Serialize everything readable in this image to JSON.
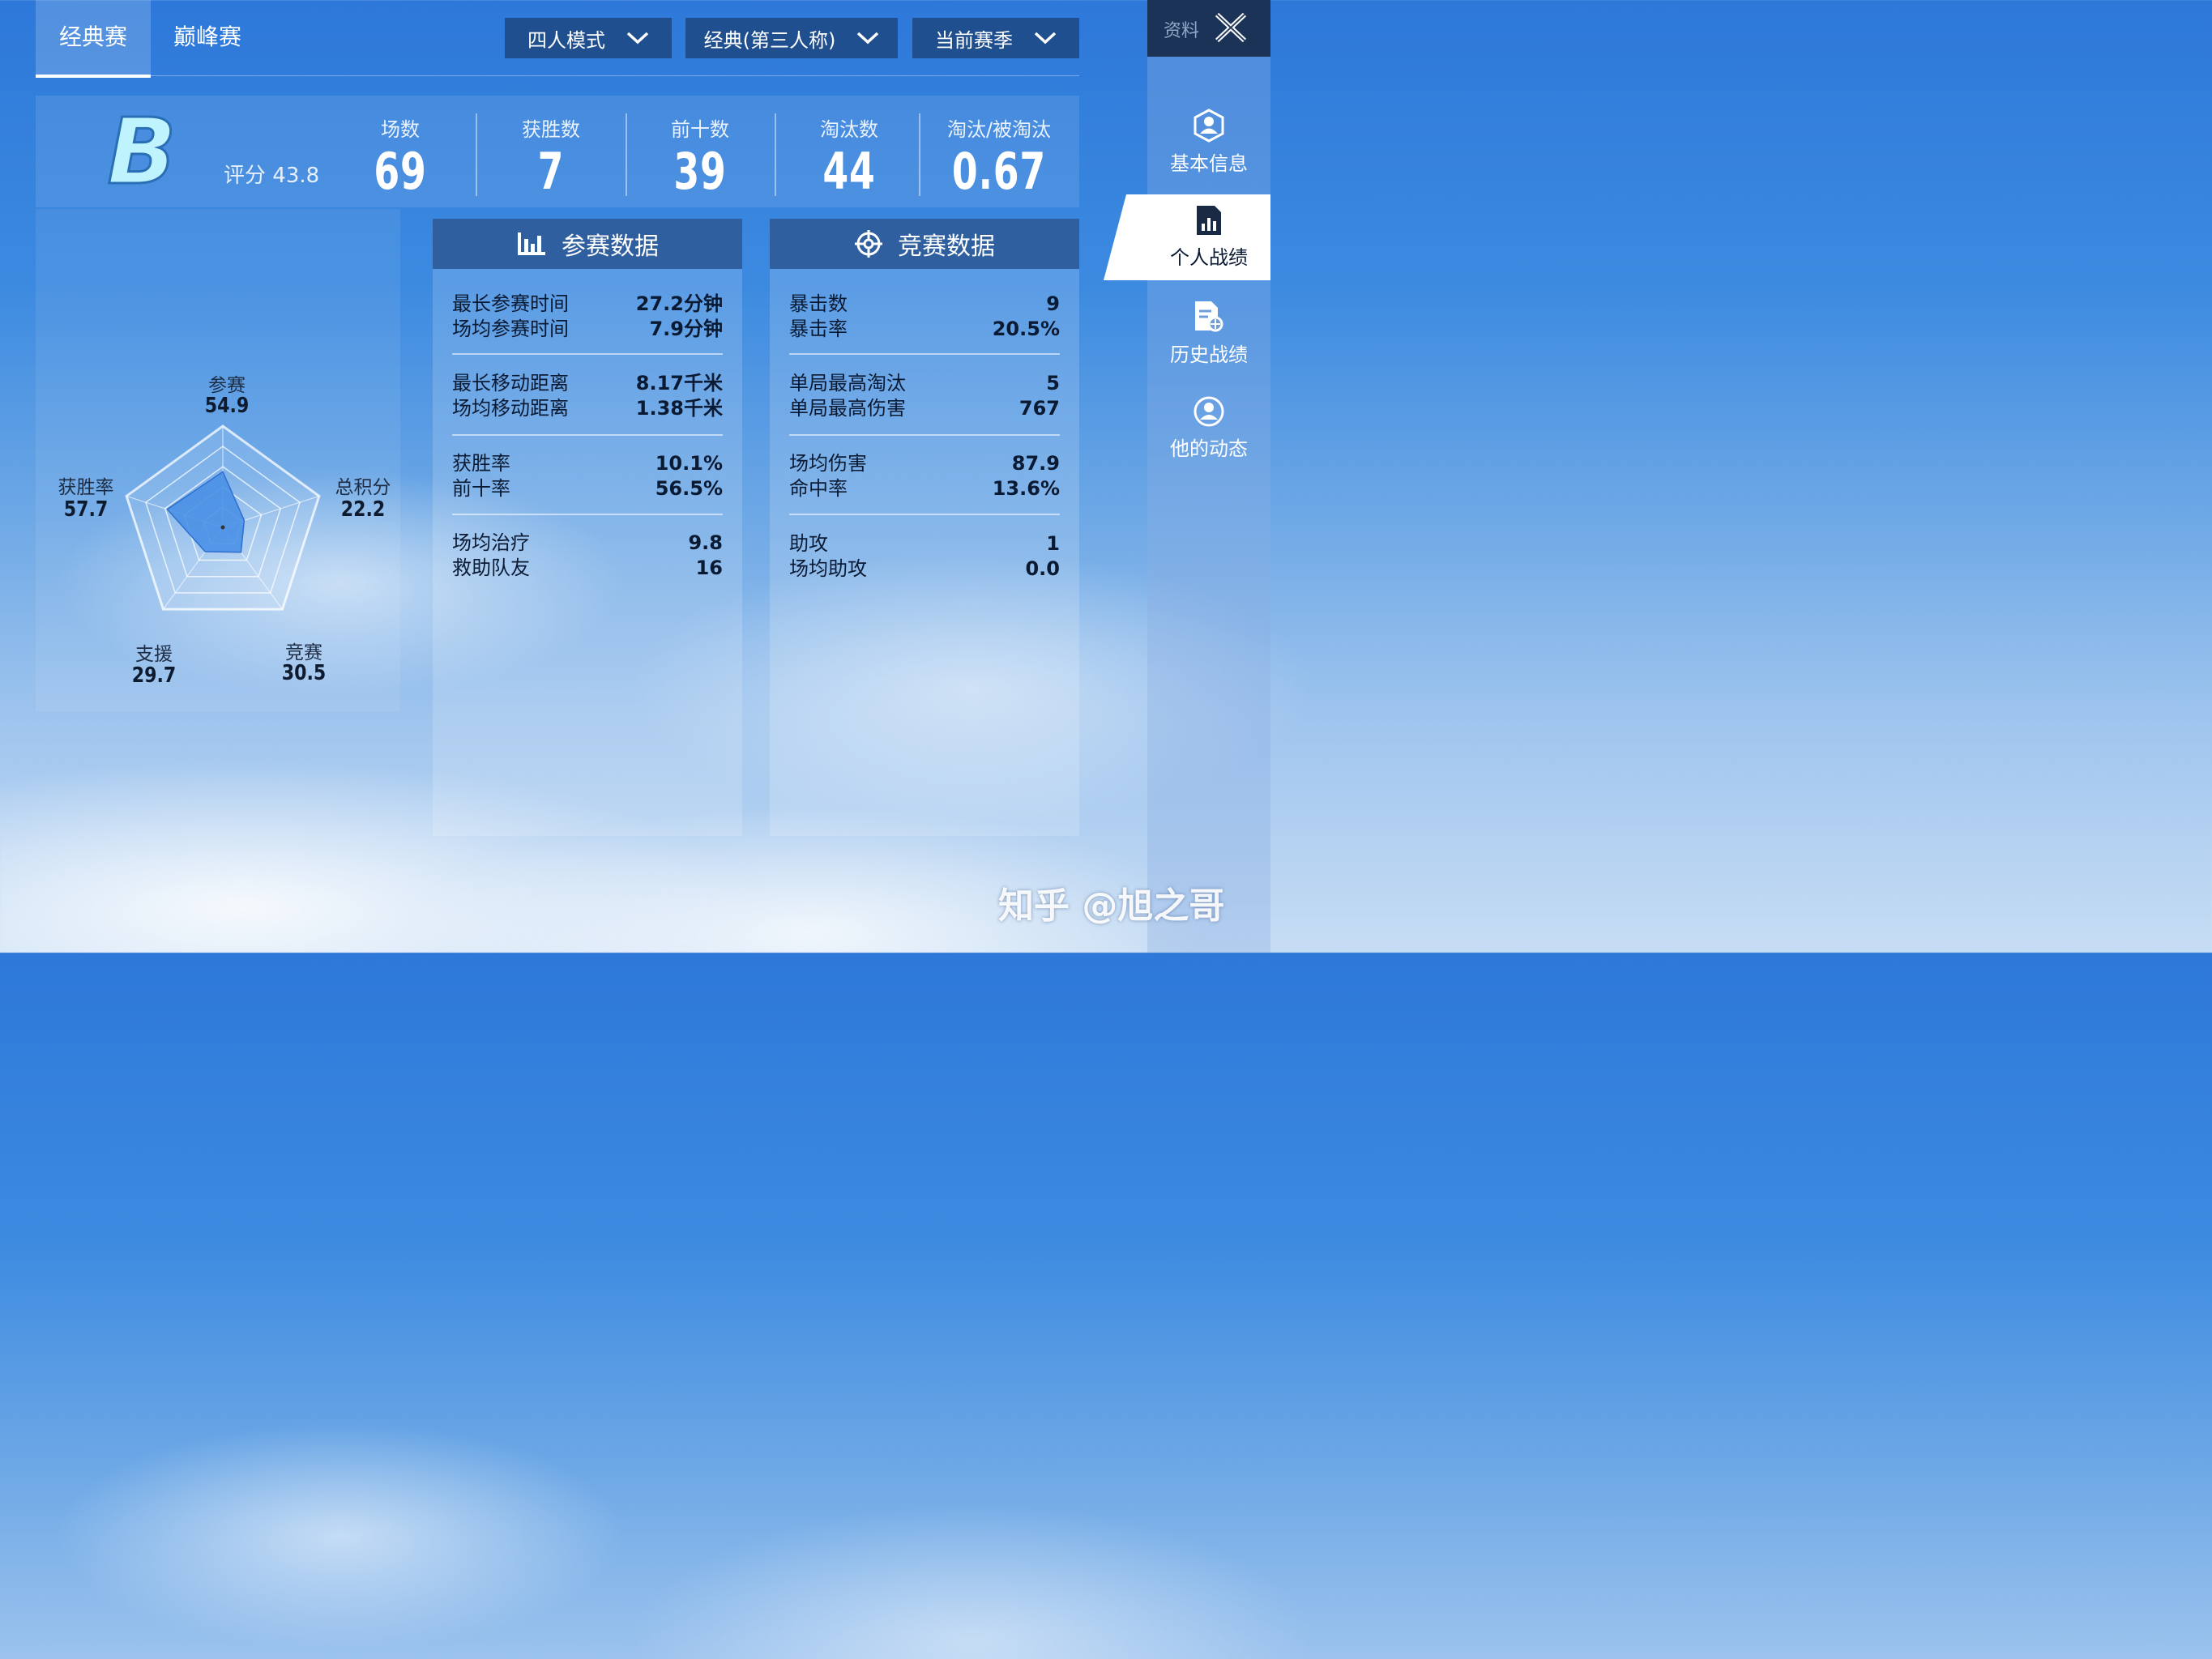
{
  "tabs": {
    "classic": "经典赛",
    "peak": "巅峰赛"
  },
  "filters": {
    "mode": "四人模式",
    "view": "经典(第三人称)",
    "season": "当前赛季"
  },
  "summary": {
    "grade": "B",
    "score_label": "评分",
    "score_value": "43.8",
    "stats": [
      {
        "label": "场数",
        "value": "69"
      },
      {
        "label": "获胜数",
        "value": "7"
      },
      {
        "label": "前十数",
        "value": "39"
      },
      {
        "label": "淘汰数",
        "value": "44"
      },
      {
        "label": "淘汰/被淘汰",
        "value": "0.67"
      }
    ]
  },
  "radar": {
    "axes": [
      {
        "label": "参赛",
        "value": "54.9"
      },
      {
        "label": "总积分",
        "value": "22.2"
      },
      {
        "label": "竞赛",
        "value": "30.5"
      },
      {
        "label": "支援",
        "value": "29.7"
      },
      {
        "label": "获胜率",
        "value": "57.7"
      }
    ]
  },
  "participation": {
    "title": "参赛数据",
    "groups": [
      [
        {
          "k": "最长参赛时间",
          "v": "27.2分钟"
        },
        {
          "k": "场均参赛时间",
          "v": "7.9分钟"
        }
      ],
      [
        {
          "k": "最长移动距离",
          "v": "8.17千米"
        },
        {
          "k": "场均移动距离",
          "v": "1.38千米"
        }
      ],
      [
        {
          "k": "获胜率",
          "v": "10.1%"
        },
        {
          "k": "前十率",
          "v": "56.5%"
        }
      ],
      [
        {
          "k": "场均治疗",
          "v": "9.8"
        },
        {
          "k": "救助队友",
          "v": "16"
        }
      ]
    ]
  },
  "combat": {
    "title": "竞赛数据",
    "groups": [
      [
        {
          "k": "暴击数",
          "v": "9"
        },
        {
          "k": "暴击率",
          "v": "20.5%"
        }
      ],
      [
        {
          "k": "单局最高淘汰",
          "v": "5"
        },
        {
          "k": "单局最高伤害",
          "v": "767"
        }
      ],
      [
        {
          "k": "场均伤害",
          "v": "87.9"
        },
        {
          "k": "命中率",
          "v": "13.6%"
        }
      ],
      [
        {
          "k": "助攻",
          "v": "1"
        },
        {
          "k": "场均助攻",
          "v": "0.0"
        }
      ]
    ]
  },
  "sidebar": {
    "header": "资料",
    "items": [
      {
        "label": "基本信息",
        "icon": "profile-hex-icon"
      },
      {
        "label": "个人战绩",
        "icon": "stats-doc-icon"
      },
      {
        "label": "历史战绩",
        "icon": "history-doc-icon"
      },
      {
        "label": "他的动态",
        "icon": "activity-user-icon"
      }
    ]
  },
  "watermark": "知乎 @旭之哥",
  "colors": {
    "accent_dark": "#1f4f8f",
    "panel_head": "#2f5f9e",
    "radar_fill": "#4a90e6",
    "sidebar_dark": "#1c3358"
  }
}
